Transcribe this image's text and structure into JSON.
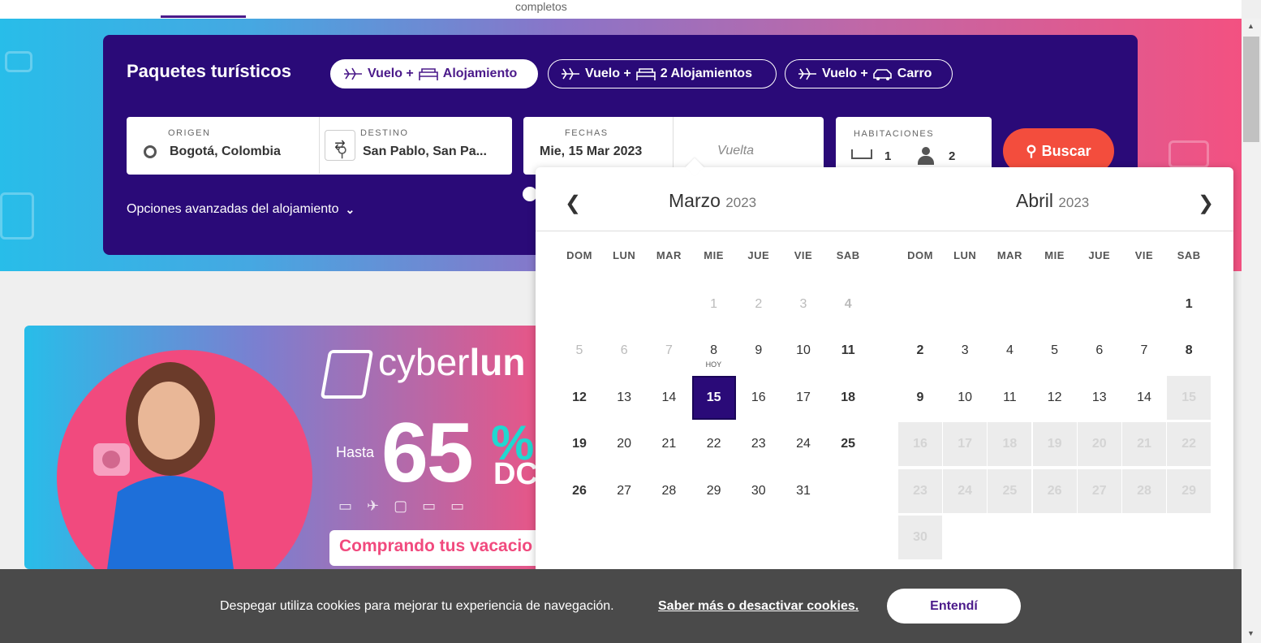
{
  "top_tab": {
    "text": "completos"
  },
  "search": {
    "title": "Paquetes turísticos",
    "tabs": [
      {
        "prefix": "Vuelo +",
        "label": "Alojamiento",
        "active": true
      },
      {
        "prefix": "Vuelo +",
        "label": "2 Alojamientos",
        "active": false
      },
      {
        "prefix": "Vuelo +",
        "label": "Carro",
        "active": false
      }
    ],
    "origin": {
      "label": "ORIGEN",
      "value": "Bogotá, Colombia"
    },
    "destination": {
      "label": "DESTINO",
      "value": "San Pablo, San Pa..."
    },
    "dates": {
      "label": "FECHAS",
      "departure": "Mie, 15 Mar 2023",
      "return_placeholder": "Vuelta"
    },
    "rooms": {
      "label": "HABITACIONES",
      "rooms": "1",
      "guests": "2"
    },
    "search_button": "Buscar",
    "advanced_options": "Opciones avanzadas del alojamiento"
  },
  "calendar": {
    "weekdays": [
      "DOM",
      "LUN",
      "MAR",
      "MIE",
      "JUE",
      "VIE",
      "SAB"
    ],
    "today_label": "HOY",
    "months": [
      {
        "name": "Marzo",
        "year": "2023"
      },
      {
        "name": "Abril",
        "year": "2023"
      }
    ]
  },
  "promo": {
    "brand_light": "cyber",
    "brand_bold": "lun",
    "prefix": "Hasta",
    "discount": "65",
    "percent": "%",
    "suffix": "DCT",
    "tagline": "Comprando tus vacacio"
  },
  "cookie_banner": {
    "text": "Despegar utiliza cookies para mejorar tu experiencia de navegación.",
    "link": "Saber más o desactivar cookies.",
    "button": "Entendí"
  },
  "colors": {
    "brand_purple": "#2a0a78",
    "accent_red": "#f34d3d",
    "promo_pink": "#f14a7e",
    "promo_teal": "#20d8d0"
  }
}
